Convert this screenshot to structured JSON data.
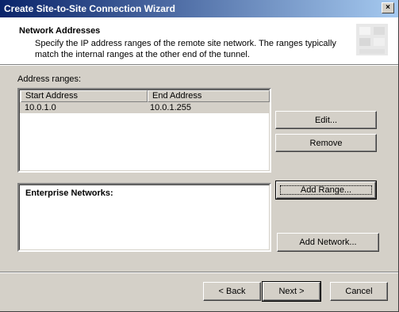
{
  "window": {
    "title": "Create Site-to-Site Connection Wizard",
    "close_glyph": "×"
  },
  "header": {
    "title": "Network Addresses",
    "description": "Specify the IP address ranges of the remote site network. The ranges typically match the internal ranges at the other end of the tunnel."
  },
  "address_ranges": {
    "label": "Address ranges:",
    "columns": [
      "Start Address",
      "End Address"
    ],
    "rows": [
      {
        "start": "10.0.1.0",
        "end": "10.0.1.255"
      }
    ]
  },
  "buttons": {
    "edit": "Edit...",
    "remove": "Remove",
    "add_range": "Add Range...",
    "add_network": "Add Network..."
  },
  "enterprise": {
    "label": "Enterprise Networks:"
  },
  "footer": {
    "back": "< Back",
    "next": "Next >",
    "cancel": "Cancel"
  }
}
